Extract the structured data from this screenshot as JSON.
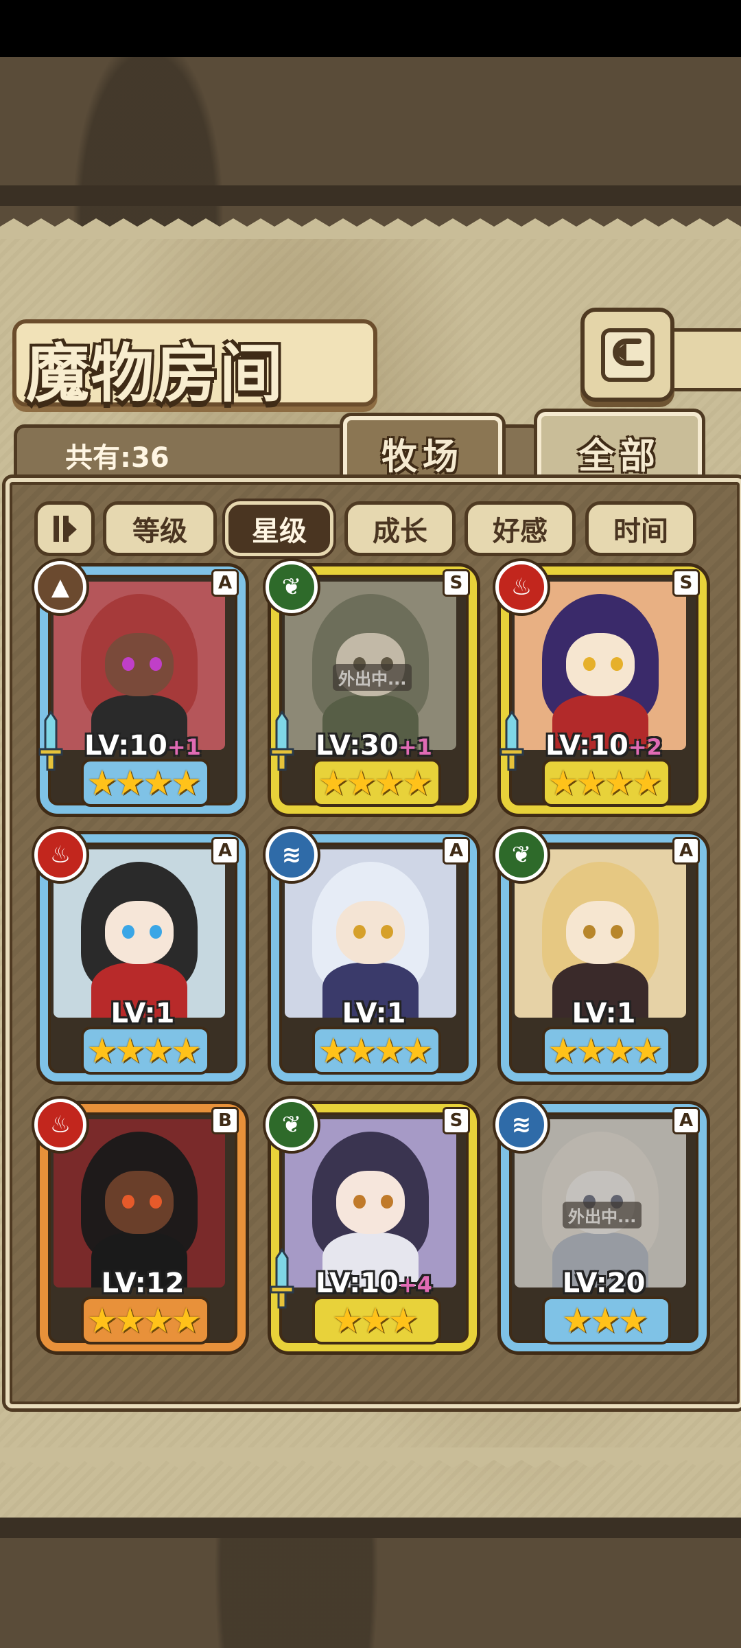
{
  "title": "魔物房间",
  "count_label": "共有:36",
  "tabs": [
    {
      "label": "牧场",
      "active": false
    },
    {
      "label": "全部",
      "active": true
    }
  ],
  "filters": [
    {
      "label": "等级",
      "active": false
    },
    {
      "label": "星级",
      "active": true
    },
    {
      "label": "成长",
      "active": false
    },
    {
      "label": "好感",
      "active": false
    },
    {
      "label": "时间",
      "active": false
    }
  ],
  "icons": {
    "back": "back-arrow-icon",
    "sort": "sort-toggle-icon"
  },
  "colors": {
    "blue_rim": "#7fc2e6",
    "gold_rim": "#e8d23a",
    "orange_rim": "#e8913a",
    "plus_text": "#e06bb4"
  },
  "monsters": [
    {
      "element": "earth",
      "rank": "A",
      "rim": "blue",
      "level": "LV:10",
      "plus": "+1",
      "stars": "★★★★",
      "equipped": true,
      "away": false,
      "away_label": ""
    },
    {
      "element": "grass",
      "rank": "S",
      "rim": "gold",
      "level": "LV:30",
      "plus": "+1",
      "stars": "★★★★",
      "equipped": true,
      "away": true,
      "away_label": "外出中..."
    },
    {
      "element": "fire",
      "rank": "S",
      "rim": "gold",
      "level": "LV:10",
      "plus": "+2",
      "stars": "★★★★",
      "equipped": true,
      "away": false,
      "away_label": ""
    },
    {
      "element": "fire",
      "rank": "A",
      "rim": "blue",
      "level": "LV:1",
      "plus": "",
      "stars": "★★★★",
      "equipped": false,
      "away": false,
      "away_label": ""
    },
    {
      "element": "water",
      "rank": "A",
      "rim": "blue",
      "level": "LV:1",
      "plus": "",
      "stars": "★★★★",
      "equipped": false,
      "away": false,
      "away_label": ""
    },
    {
      "element": "grass",
      "rank": "A",
      "rim": "blue",
      "level": "LV:1",
      "plus": "",
      "stars": "★★★★",
      "equipped": false,
      "away": false,
      "away_label": ""
    },
    {
      "element": "fire",
      "rank": "B",
      "rim": "orange",
      "level": "LV:12",
      "plus": "",
      "stars": "★★★★",
      "equipped": false,
      "away": false,
      "away_label": ""
    },
    {
      "element": "grass",
      "rank": "S",
      "rim": "gold",
      "level": "LV:10",
      "plus": "+4",
      "stars": "★★★",
      "equipped": true,
      "away": false,
      "away_label": ""
    },
    {
      "element": "water",
      "rank": "A",
      "rim": "blue",
      "level": "LV:20",
      "plus": "",
      "stars": "★★★",
      "equipped": false,
      "away": true,
      "away_label": "外出中..."
    }
  ]
}
